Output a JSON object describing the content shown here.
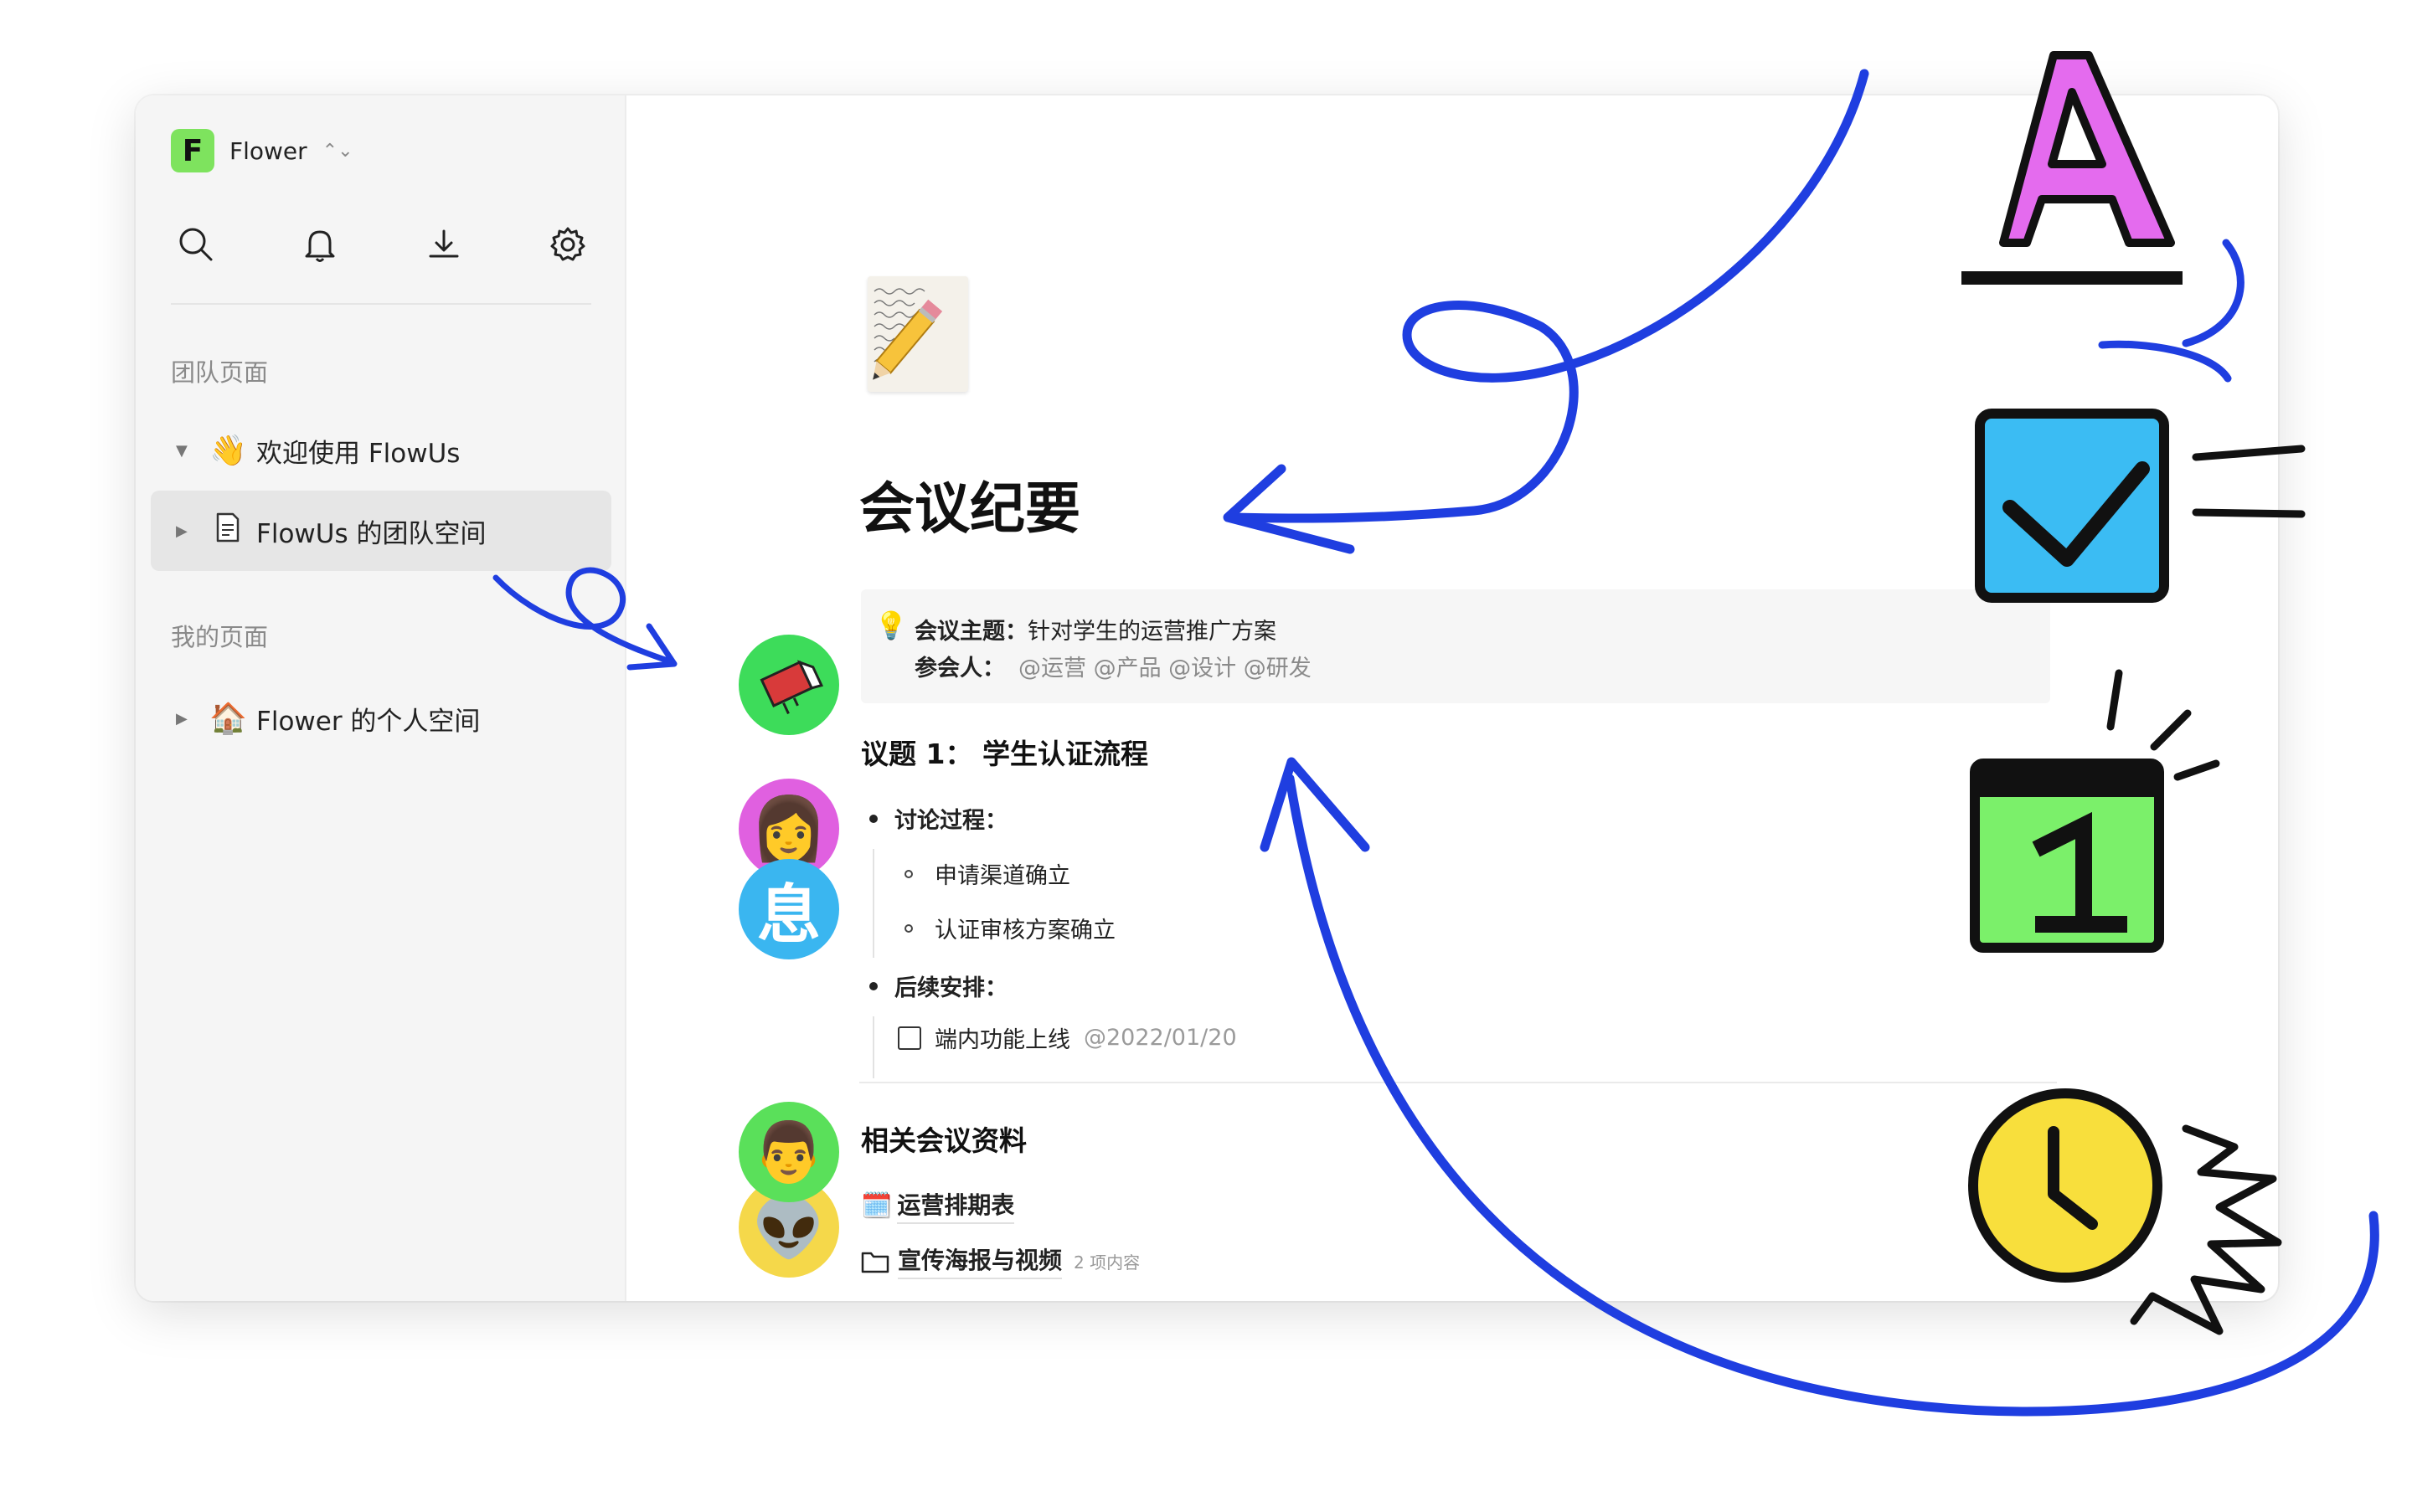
{
  "workspace": {
    "logo_letter": "F",
    "name": "Flower",
    "switch_glyph": "⌃⌄",
    "logo_color": "#7ee35e"
  },
  "toolbar": {
    "icons": [
      "search-icon",
      "bell-icon",
      "download-icon",
      "gear-icon"
    ]
  },
  "sidebar": {
    "team_section": "团队页面",
    "my_section": "我的页面",
    "items": [
      {
        "caret": "▼",
        "emoji": "👋",
        "label": "欢迎使用 FlowUs"
      },
      {
        "caret": "▶",
        "emoji": "",
        "label": "FlowUs 的团队空间"
      },
      {
        "caret": "▶",
        "emoji": "🏠",
        "label": "Flower 的个人空间"
      }
    ]
  },
  "page": {
    "title": "会议纪要",
    "callout": {
      "icon": "💡",
      "topic_label": "会议主题：",
      "topic_value": "针对学生的运营推广方案",
      "attendee_label": "参会人：",
      "attendees": "@运营 @产品 @设计 @研发"
    },
    "agenda": {
      "heading": "议题 1： 学生认证流程",
      "discussion_label": "讨论过程：",
      "discussion_items": [
        "申请渠道确立",
        "认证审核方案确立"
      ],
      "followup_label": "后续安排：",
      "todo_label": "端内功能上线",
      "todo_date": "@2022/01/20"
    },
    "related": {
      "heading": "相关会议资料",
      "links": [
        {
          "icon": "🗓️",
          "label": "运营排期表",
          "meta": ""
        },
        {
          "icon": "🗀",
          "label": "宣传海报与视频",
          "meta": "2 项内容"
        }
      ]
    }
  },
  "avatars": [
    {
      "name": "book-avatar",
      "emoji": "📕",
      "color": "#3ddc5a"
    },
    {
      "name": "woman-avatar",
      "emoji": "👩",
      "color": "#e060e0"
    },
    {
      "name": "rest-avatar",
      "text": "息",
      "color": "#3ab6f0"
    },
    {
      "name": "man-avatar",
      "emoji": "👨",
      "color": "#5ae05a"
    },
    {
      "name": "alien-avatar",
      "emoji": "👽",
      "color": "#f5d84a"
    }
  ],
  "decor": {
    "letter_icon": "A",
    "calendar_icon": "1",
    "arrow_color": "#1f3ee0",
    "letter_color": "#e46bee",
    "check_color": "#3bbcf3",
    "calendar_color": "#7bf06a",
    "clock_color": "#f8df3c"
  }
}
